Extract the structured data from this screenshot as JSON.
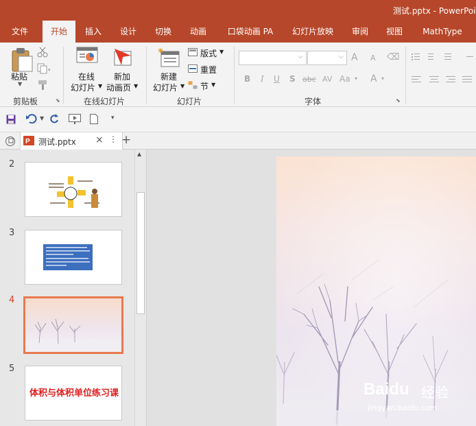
{
  "window": {
    "title": "测试.pptx - PowerPoint"
  },
  "tabs": [
    "文件",
    "开始",
    "插入",
    "设计",
    "切换",
    "动画",
    "口袋动画 PA",
    "幻灯片放映",
    "审阅",
    "视图",
    "MathType"
  ],
  "ribbon": {
    "clipboard": {
      "paste_label": "粘贴",
      "group_label": "剪贴板"
    },
    "online_slides": {
      "online_label_1": "在线",
      "online_label_2": "幻灯片",
      "newanim_label_1": "新加",
      "newanim_label_2": "动画页",
      "group_label": "在线幻灯片"
    },
    "slides": {
      "new_label_1": "新建",
      "new_label_2": "幻灯片",
      "layout_label": "版式",
      "reset_label": "重置",
      "section_label": "节",
      "group_label": "幻灯片"
    },
    "font": {
      "group_label": "字体",
      "bold": "B",
      "italic": "I",
      "underline": "U",
      "shadow": "S",
      "strike": "abc",
      "spacing": "AV",
      "case": "Aa",
      "color": "A",
      "grow": "A",
      "shrink": "A"
    }
  },
  "document_tab": {
    "name": "测试.pptx"
  },
  "slides": [
    {
      "number": "2",
      "selected": false
    },
    {
      "number": "3",
      "selected": false
    },
    {
      "number": "4",
      "selected": true
    },
    {
      "number": "5",
      "selected": false,
      "title": "体积与体积单位练习课"
    }
  ],
  "watermark": {
    "brand": "Baidu",
    "sub": "经验",
    "url": "jingyan.baidu.com"
  },
  "colors": {
    "accent": "#b7472a",
    "selection": "#e9794f",
    "slide5_title": "#e02020"
  }
}
